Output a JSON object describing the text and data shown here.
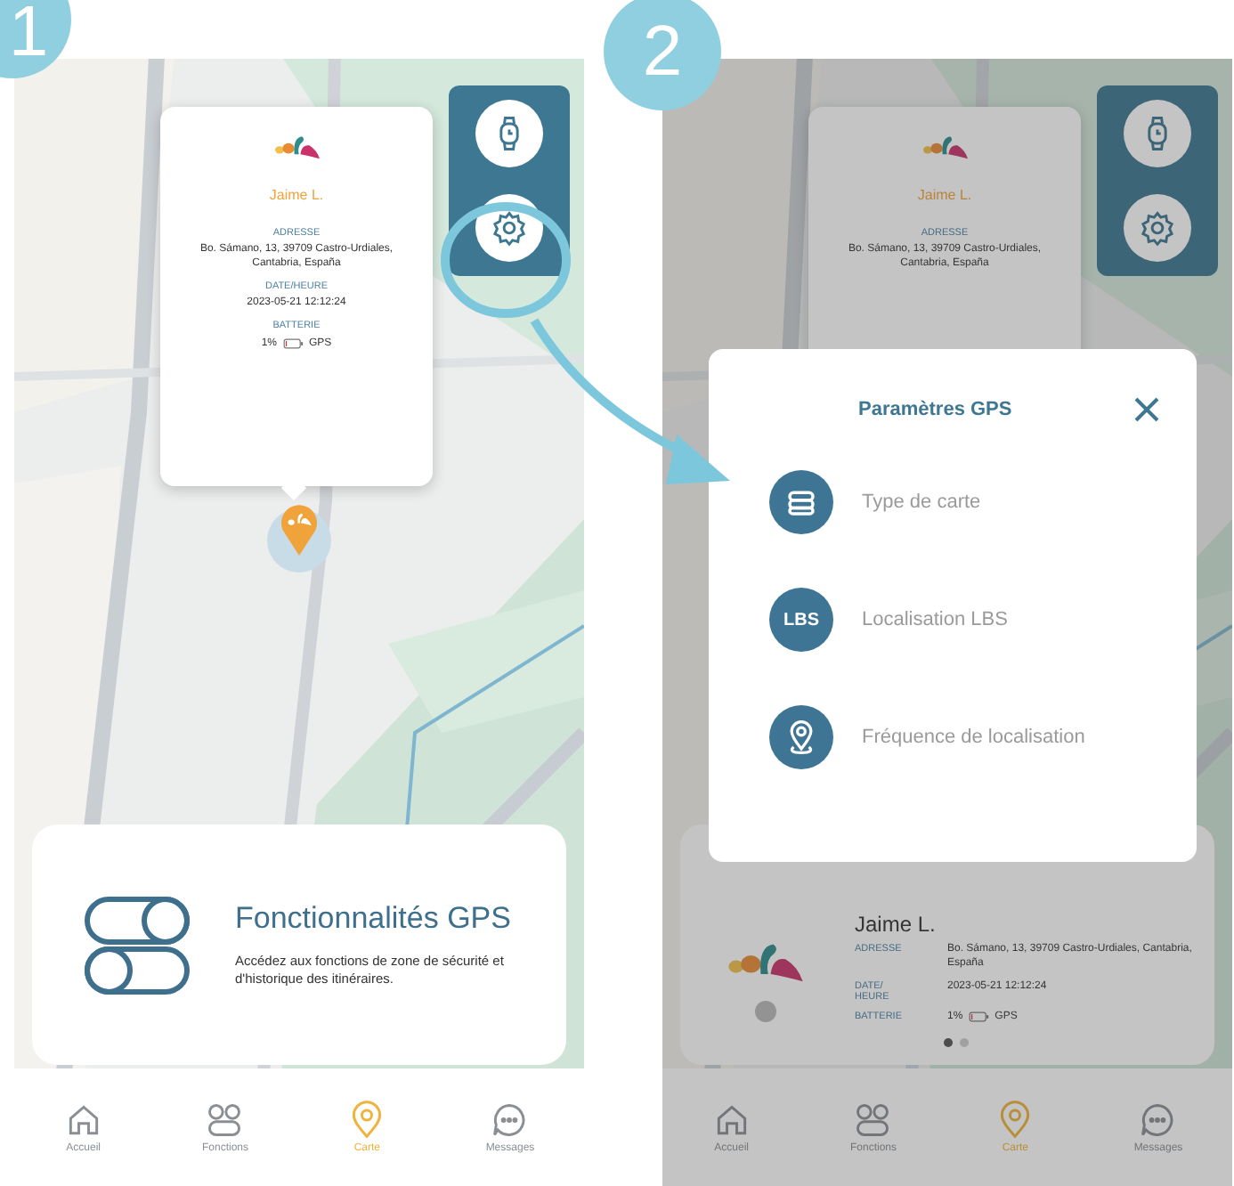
{
  "steps": [
    {
      "number": "1"
    },
    {
      "number": "2"
    }
  ],
  "screen_1": {
    "popup": {
      "name": "Jaime L.",
      "fields": [
        {
          "label": "ADRESSE",
          "value": "Bo. Sámano, 13, 39709 Castro-Urdiales, Cantabria, España"
        },
        {
          "label": "DATE/HEURE",
          "value": "2023-05-21 12:12:24"
        },
        {
          "label": "BATTERIE",
          "battery": "1%",
          "gps": "GPS"
        }
      ]
    },
    "feature_card": {
      "title": "Fonctionnalités GPS",
      "description": "Accédez aux fonctions de zone de sécurité et d'historique des itinéraires."
    },
    "tab_bar": [
      {
        "label": "Accueil",
        "kind": "home",
        "selected": false
      },
      {
        "label": "Fonctions",
        "kind": "grid",
        "selected": false
      },
      {
        "label": "Carte",
        "kind": "pin",
        "selected": true
      },
      {
        "label": "Messages",
        "kind": "chat",
        "selected": false
      }
    ]
  },
  "screen_2": {
    "popup": {
      "name": "Jaime L.",
      "fields": [
        {
          "label": "ADRESSE",
          "value": "Bo. Sámano, 13, 39709 Castro-Urdiales, Cantabria, España"
        }
      ]
    },
    "modal": {
      "title": "Paramètres GPS",
      "items": [
        {
          "label": "Type de carte",
          "kind": "stack"
        },
        {
          "label": "Localisation LBS",
          "kind": "lbs",
          "badge": "LBS"
        },
        {
          "label": "Fréquence de localisation",
          "kind": "pin"
        }
      ]
    },
    "device_card": {
      "name": "Jaime L.",
      "rows": [
        {
          "label": "ADRESSE",
          "value": "Bo. Sámano, 13, 39709 Castro-Urdiales, Cantabria, España"
        },
        {
          "label": "DATE/ HEURE",
          "value": "2023-05-21 12:12:24"
        },
        {
          "label": "BATTERIE",
          "battery": "1%",
          "gps": "GPS"
        }
      ],
      "page_dots": [
        {
          "selected": true
        },
        {
          "selected": false
        }
      ]
    },
    "tab_bar": [
      {
        "label": "Accueil",
        "kind": "home",
        "selected": false
      },
      {
        "label": "Fonctions",
        "kind": "grid",
        "selected": false
      },
      {
        "label": "Carte",
        "kind": "pin",
        "selected": true
      },
      {
        "label": "Messages",
        "kind": "chat",
        "selected": false
      }
    ]
  }
}
